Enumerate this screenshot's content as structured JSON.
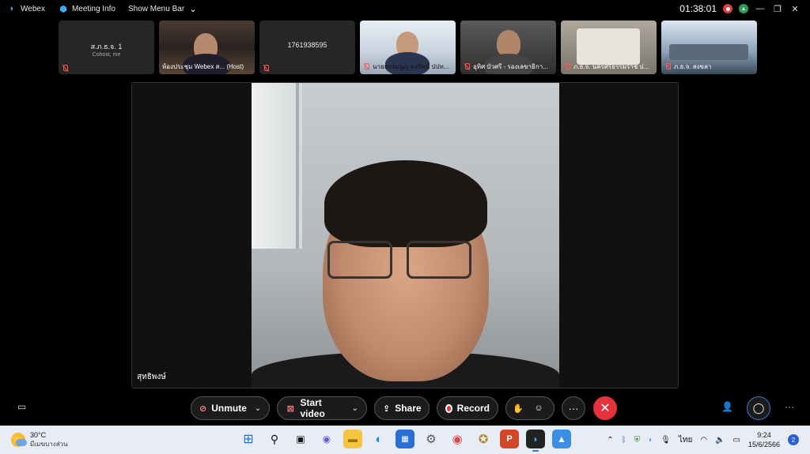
{
  "topbar": {
    "app_name": "Webex",
    "meeting_info": "Meeting Info",
    "show_menu_bar": "Show Menu Bar",
    "clock": "01:38:01"
  },
  "participants": [
    {
      "name": "ส.ภ.ธ.จ. 1",
      "subtitle": "Cohost, me",
      "has_video": false
    },
    {
      "name": "ห้องประชุม Webex ส... (Host)",
      "has_video": true
    },
    {
      "name": "1761938595",
      "has_video": false
    },
    {
      "name": "นายธรรมนูญ คงรัตน์ ปปท...",
      "has_video": true
    },
    {
      "name": "อุทิศ บัวศรี - รองเลขาธิกา...",
      "has_video": true
    },
    {
      "name": "ภ.ธ.จ. นครศรีธรรมราช ป...",
      "has_video": true
    },
    {
      "name": "ภ.ธ.จ. สงขลา",
      "has_video": true
    }
  ],
  "stage": {
    "speaker_name": "สุทธิพงษ์"
  },
  "controls": {
    "unmute": "Unmute",
    "start_video": "Start video",
    "share": "Share",
    "record": "Record",
    "more": "···"
  },
  "taskbar": {
    "weather_temp": "30°C",
    "weather_desc": "มีเมฆบางส่วน",
    "language": "ไทย",
    "time": "9:24",
    "date": "15/6/2566",
    "notification_count": "2"
  },
  "colors": {
    "leave": "#e3333c",
    "record": "#e33b3b",
    "accent_blue": "#2a5fd0"
  }
}
